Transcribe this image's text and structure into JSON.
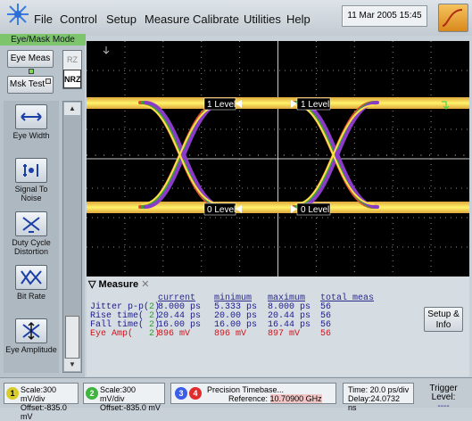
{
  "menu": {
    "items": [
      "File",
      "Control",
      "Setup",
      "Measure",
      "Calibrate",
      "Utilities",
      "Help"
    ],
    "datetime": "11 Mar 2005  15:45"
  },
  "mode_tab": "Eye/Mask Mode",
  "left_panel": {
    "eye_meas": "Eye Meas",
    "msk_test": "Msk Test",
    "rz": "RZ",
    "nrz": "NRZ",
    "tools": [
      {
        "label": "Eye Width",
        "icon": "eye-width-icon"
      },
      {
        "label": "Signal To Noise",
        "icon": "signal-to-noise-icon"
      },
      {
        "label": "Duty Cycle Distortion",
        "icon": "duty-cycle-icon"
      },
      {
        "label": "Bit Rate",
        "icon": "bit-rate-icon"
      },
      {
        "label": "Eye Amplitude",
        "icon": "eye-amplitude-icon"
      }
    ]
  },
  "display": {
    "markers": [
      "1 Level",
      "1 Level",
      "0 Level",
      "0 Level"
    ]
  },
  "measure": {
    "tab_label": "Measure",
    "headers": [
      "current",
      "minimum",
      "maximum",
      "total meas"
    ],
    "rows": [
      {
        "name": "Jitter p-p(",
        "ch": "2",
        "current": "8.000 ps",
        "minimum": "5.333 ps",
        "maximum": "8.000 ps",
        "total": "56",
        "color": "#1c1c8c"
      },
      {
        "name": "Rise time(",
        "ch": "2",
        "current": "20.44 ps",
        "minimum": "20.00 ps",
        "maximum": "20.44 ps",
        "total": "56",
        "color": "#1c1c8c"
      },
      {
        "name": "Fall time(",
        "ch": "2",
        "current": "16.00 ps",
        "minimum": "16.00 ps",
        "maximum": "16.44 ps",
        "total": "56",
        "color": "#1c1c8c"
      },
      {
        "name": "Eye Amp(",
        "ch": "2",
        "current": "896 mV",
        "minimum": "896 mV",
        "maximum": "897 mV",
        "total": "56",
        "color": "#d0141c"
      }
    ],
    "setup_info": "Setup & Info"
  },
  "status": {
    "ch1": {
      "num": "1",
      "scale": "Scale:300 mV/div",
      "offset": "Offset:-835.0 mV"
    },
    "ch2": {
      "num": "2",
      "scale": "Scale:300 mV/div",
      "offset": "Offset:-835.0 mV"
    },
    "ch3": "3",
    "ch4": "4",
    "timebase_label": "Precision Timebase...",
    "reference_label": "Reference:",
    "reference_value": "10.70900 GHz",
    "time": "Time: 20.0 ps/div",
    "delay": "Delay:24.0732 ns",
    "trigger_label": "Trigger Level:",
    "trigger_value": "----"
  },
  "colors": {
    "ch1": "#e8e040",
    "ch2": "#3fb43f",
    "ch3": "#3a5ee8",
    "ch4": "#e02c2c",
    "graticule": "#000000"
  }
}
